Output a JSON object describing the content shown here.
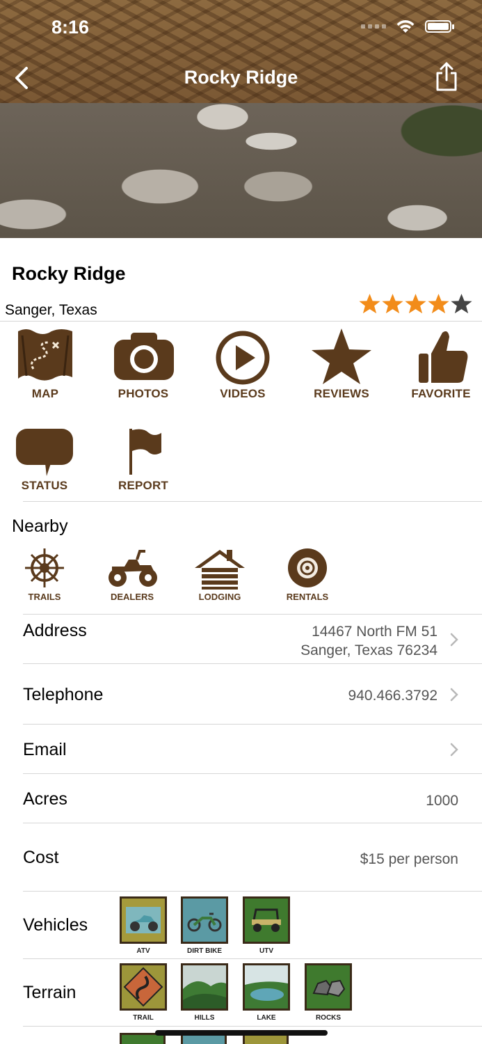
{
  "status_bar": {
    "time": "8:16"
  },
  "nav": {
    "title": "Rocky Ridge"
  },
  "place": {
    "name": "Rocky Ridge",
    "location": "Sanger, Texas",
    "rating": 4,
    "rating_max": 5,
    "star_color": "#f28c1a"
  },
  "actions": [
    {
      "label": "MAP",
      "icon": "map-icon"
    },
    {
      "label": "PHOTOS",
      "icon": "camera-icon"
    },
    {
      "label": "VIDEOS",
      "icon": "play-icon"
    },
    {
      "label": "REVIEWS",
      "icon": "star-icon"
    },
    {
      "label": "FAVORITE",
      "icon": "thumbs-up-icon"
    },
    {
      "label": "STATUS",
      "icon": "speech-bubble-icon"
    },
    {
      "label": "REPORT",
      "icon": "flag-icon"
    }
  ],
  "nearby": {
    "title": "Nearby",
    "items": [
      {
        "label": "TRAILS",
        "icon": "compass-icon"
      },
      {
        "label": "DEALERS",
        "icon": "atv-icon"
      },
      {
        "label": "LODGING",
        "icon": "cabin-icon"
      },
      {
        "label": "RENTALS",
        "icon": "tire-icon"
      }
    ]
  },
  "details": {
    "address": {
      "label": "Address",
      "line1": "14467 North FM 51",
      "line2": "Sanger, Texas 76234"
    },
    "telephone": {
      "label": "Telephone",
      "value": "940.466.3792"
    },
    "email": {
      "label": "Email"
    },
    "acres": {
      "label": "Acres",
      "value": "1000"
    },
    "cost": {
      "label": "Cost",
      "value": "$15 per person"
    }
  },
  "vehicles": {
    "label": "Vehicles",
    "items": [
      "ATV",
      "DIRT BIKE",
      "UTV"
    ]
  },
  "terrain": {
    "label": "Terrain",
    "items": [
      "TRAIL",
      "HILLS",
      "LAKE",
      "ROCKS"
    ]
  },
  "brand_color": "#5a3a1c"
}
